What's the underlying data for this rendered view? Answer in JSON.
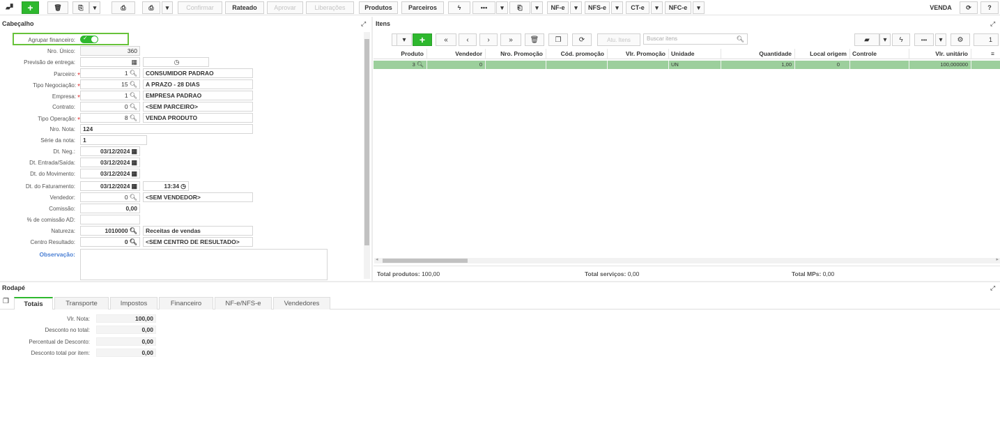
{
  "toolbar": {
    "buttons": {
      "confirmar": "Confirmar",
      "rateado": "Rateado",
      "aprovar": "Aprovar",
      "liberacoes": "Liberações",
      "produtos": "Produtos",
      "parceiros": "Parceiros",
      "more": "•••",
      "nfe": "NF-e",
      "nfse": "NFS-e",
      "cte": "CT-e",
      "nfce": "NFC-e"
    },
    "mode": "VENDA"
  },
  "cabecalho": {
    "title": "Cabeçalho",
    "fields": {
      "agrupar": {
        "label": "Agrupar financeiro:",
        "on": true
      },
      "nro_unico": {
        "label": "Nro. Único:",
        "value": "360"
      },
      "previsao": {
        "label": "Previsão de entrega:",
        "value": ""
      },
      "parceiro": {
        "label": "Parceiro:",
        "code": "1",
        "desc": "CONSUMIDOR PADRAO"
      },
      "tipo_neg": {
        "label": "Tipo Negociação:",
        "code": "15",
        "desc": "A PRAZO - 28 DIAS"
      },
      "empresa": {
        "label": "Empresa:",
        "code": "1",
        "desc": "EMPRESA PADRAO"
      },
      "contrato": {
        "label": "Contrato:",
        "code": "0",
        "desc": "<SEM PARCEIRO>"
      },
      "tipo_op": {
        "label": "Tipo Operação:",
        "code": "8",
        "desc": "VENDA PRODUTO"
      },
      "nro_nota": {
        "label": "Nro. Nota:",
        "value": "124"
      },
      "serie": {
        "label": "Série da nota:",
        "value": "1"
      },
      "dt_neg": {
        "label": "Dt. Neg.:",
        "value": "03/12/2024"
      },
      "dt_entrada": {
        "label": "Dt. Entrada/Saída:",
        "value": "03/12/2024"
      },
      "dt_mov": {
        "label": "Dt. do Movimento:",
        "value": "03/12/2024"
      },
      "dt_fat": {
        "label": "Dt. do Faturamento:",
        "value": "03/12/2024",
        "time": "13:34"
      },
      "vendedor": {
        "label": "Vendedor:",
        "code": "0",
        "desc": "<SEM VENDEDOR>"
      },
      "comissao": {
        "label": "Comissão:",
        "value": "0,00"
      },
      "pct_comissao": {
        "label": "% de comissão AD:",
        "value": ""
      },
      "natureza": {
        "label": "Natureza:",
        "code": "1010000",
        "desc": "Receitas de vendas"
      },
      "centro": {
        "label": "Centro Resultado:",
        "code": "0",
        "desc": "<SEM CENTRO DE RESULTADO>"
      },
      "observacao": {
        "label": "Observação:",
        "value": ""
      }
    }
  },
  "itens": {
    "title": "Itens",
    "atu_label": "Atu. Itens",
    "search_placeholder": "Buscar itens",
    "page": "1",
    "columns": [
      "Produto",
      "Vendedor",
      "Nro. Promoção",
      "Cód. promoção",
      "Vlr. Promoção",
      "Unidade",
      "Quantidade",
      "Local origem",
      "Controle",
      "Vlr. unitário"
    ],
    "rows": [
      {
        "produto": "3",
        "vendedor": "0",
        "nro_promocao": "",
        "cod_promocao": "",
        "vlr_promocao": "",
        "unidade": "UN",
        "quantidade": "1,00",
        "local_origem": "0",
        "controle": "",
        "vlr_unitario": "100,000000"
      }
    ],
    "totals": {
      "produtos_label": "Total produtos:",
      "produtos_value": "100,00",
      "servicos_label": "Total serviços:",
      "servicos_value": "0,00",
      "mps_label": "Total MPs:",
      "mps_value": "0,00"
    }
  },
  "rodape": {
    "title": "Rodapé",
    "tabs": [
      "Totais",
      "Transporte",
      "Impostos",
      "Financeiro",
      "NF-e/NFS-e",
      "Vendedores"
    ],
    "active_tab": "Totais",
    "fields": [
      {
        "label": "Vlr. Nota:",
        "value": "100,00"
      },
      {
        "label": "Desconto no total:",
        "value": "0,00"
      },
      {
        "label": "Percentual de Desconto:",
        "value": "0,00"
      },
      {
        "label": "Desconto total por item:",
        "value": "0,00"
      }
    ]
  },
  "colors": {
    "accent": "#2eb82e",
    "row_highlight": "#9ccf9c",
    "required": "#e03030",
    "link_label": "#4a7fd4"
  }
}
